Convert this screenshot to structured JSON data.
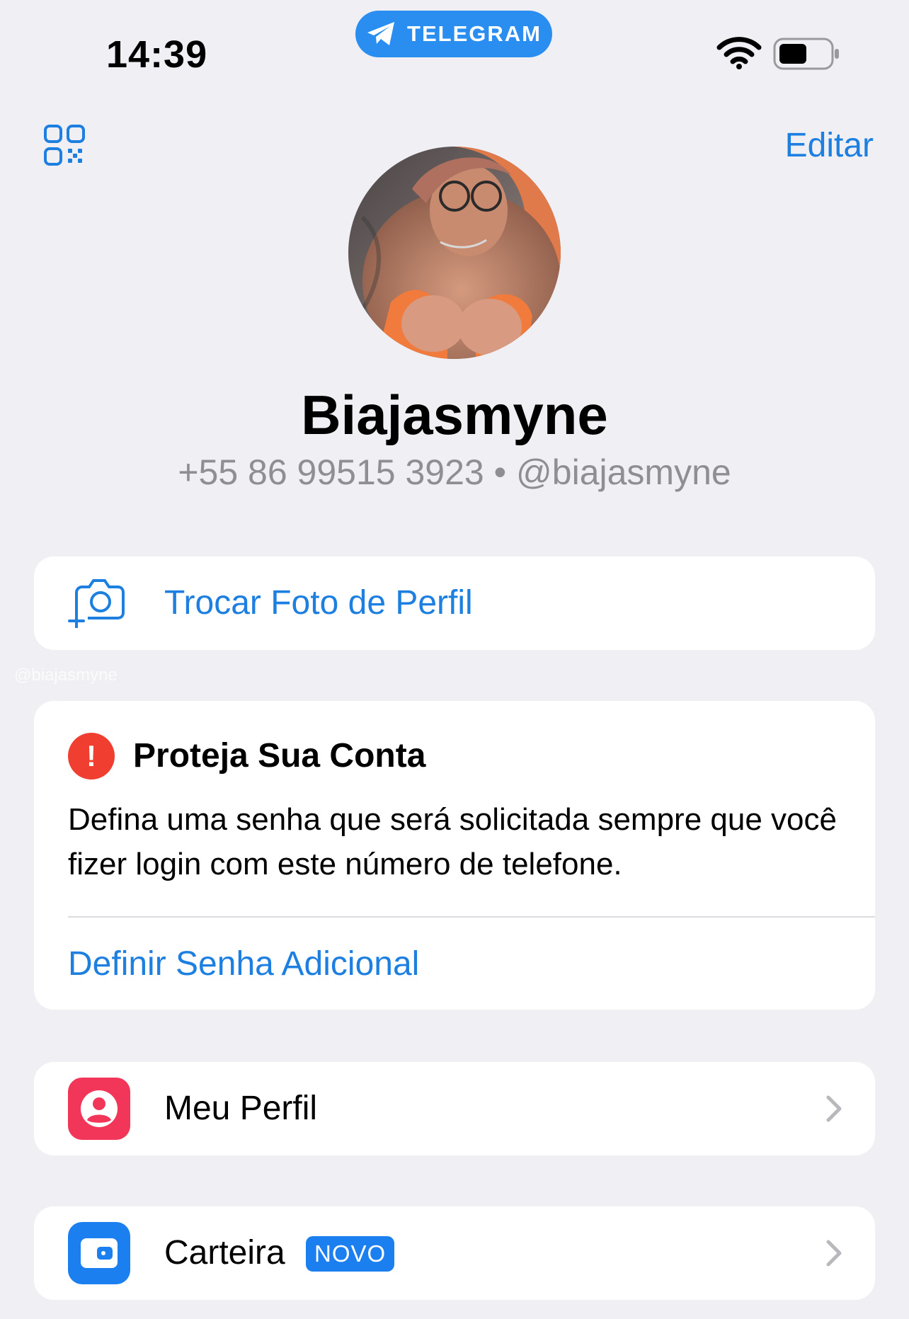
{
  "status_bar": {
    "time": "14:39",
    "app_pill": "TELEGRAM",
    "battery_level": 0.5
  },
  "header": {
    "edit_label": "Editar",
    "qr_icon": "qr-code-icon"
  },
  "profile": {
    "name": "Biajasmyne",
    "phone": "+55 86 99515 3923",
    "separator": "•",
    "username": "@biajasmyne"
  },
  "change_photo": {
    "label": "Trocar Foto de Perfil",
    "icon": "camera-add-icon"
  },
  "protect_account": {
    "title": "Proteja Sua Conta",
    "body": "Defina uma senha que será solicitada sempre que você fizer login com este número de telefone.",
    "action": "Definir Senha Adicional",
    "alert_glyph": "!"
  },
  "menu": {
    "items": [
      {
        "label": "Meu Perfil",
        "icon": "person-circle-icon",
        "color": "#f2365a"
      },
      {
        "label": "Carteira",
        "badge": "NOVO",
        "icon": "wallet-icon",
        "color": "#1b7ff0"
      }
    ]
  },
  "watermark": "@biajasmyne",
  "colors": {
    "accent": "#1d7fe0",
    "background": "#efeff4",
    "alert": "#f03e30"
  }
}
